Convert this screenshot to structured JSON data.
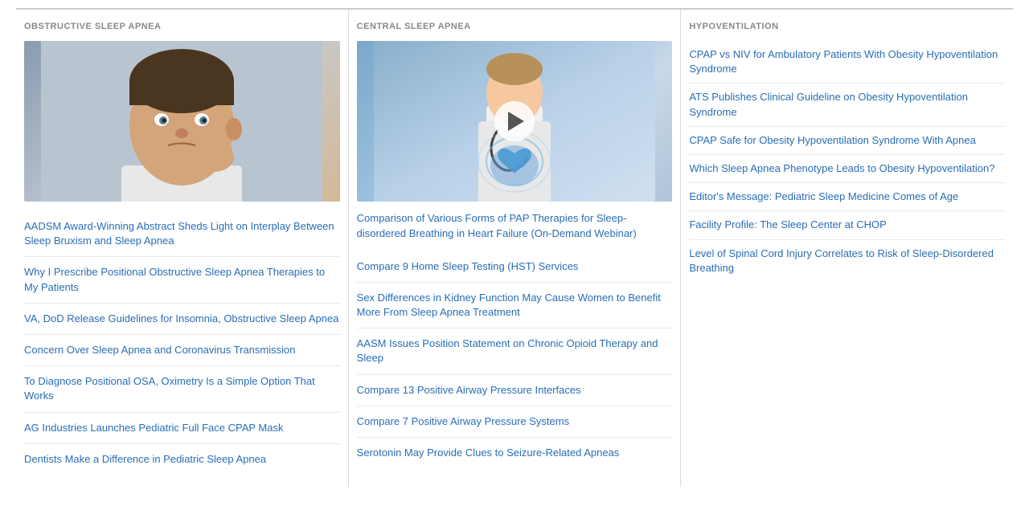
{
  "columns": [
    {
      "id": "obstructive",
      "header": "OBSTRUCTIVE SLEEP APNEA",
      "featured_image_type": "person",
      "articles": [
        "AADSM Award-Winning Abstract Sheds Light on Interplay Between Sleep Bruxism and Sleep Apnea",
        "Why I Prescribe Positional Obstructive Sleep Apnea Therapies to My Patients",
        "VA, DoD Release Guidelines for Insomnia, Obstructive Sleep Apnea",
        "Concern Over Sleep Apnea and Coronavirus Transmission",
        "To Diagnose Positional OSA, Oximetry Is a Simple Option That Works",
        "AG Industries Launches Pediatric Full Face CPAP Mask",
        "Dentists Make a Difference in Pediatric Sleep Apnea"
      ]
    },
    {
      "id": "central",
      "header": "CENTRAL SLEEP APNEA",
      "featured_image_type": "video",
      "featured_article": "Comparison of Various Forms of PAP Therapies for Sleep-disordered Breathing in Heart Failure (On-Demand Webinar)",
      "articles": [
        "Compare 9 Home Sleep Testing (HST) Services",
        "Sex Differences in Kidney Function May Cause Women to Benefit More From Sleep Apnea Treatment",
        "AASM Issues Position Statement on Chronic Opioid Therapy and Sleep",
        "Compare 13 Positive Airway Pressure Interfaces",
        "Compare 7 Positive Airway Pressure Systems",
        "Serotonin May Provide Clues to Seizure-Related Apneas"
      ]
    },
    {
      "id": "hypoventilation",
      "header": "HYPOVENTILATION",
      "articles": [
        "CPAP vs NIV for Ambulatory Patients With Obesity Hypoventilation Syndrome",
        "ATS Publishes Clinical Guideline on Obesity Hypoventilation Syndrome",
        "CPAP Safe for Obesity Hypoventilation Syndrome With Apnea",
        "Which Sleep Apnea Phenotype Leads to Obesity Hypoventilation?",
        "Editor's Message: Pediatric Sleep Medicine Comes of Age",
        "Facility Profile: The Sleep Center at CHOP",
        "Level of Spinal Cord Injury Correlates to Risk of Sleep-Disordered Breathing"
      ]
    }
  ]
}
